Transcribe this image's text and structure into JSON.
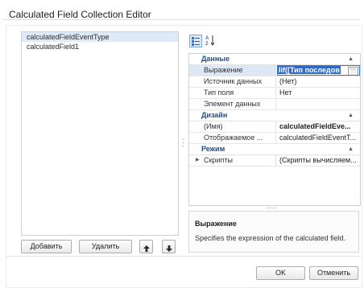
{
  "window": {
    "title": "Calculated Field Collection Editor"
  },
  "list": {
    "items": [
      "calculatedFieldEventType",
      "calculatedField1"
    ],
    "selected_index": 0
  },
  "buttons": {
    "add": "Добавить",
    "remove": "Удалить",
    "ok": "OK",
    "cancel": "Отменить"
  },
  "toolbar": {
    "categorized_icon": "categorized-icon",
    "alphabetical_icon": "sort-az-icon"
  },
  "property_grid": {
    "categories": [
      {
        "name": "Данные",
        "rows": [
          {
            "name": "Выражение",
            "value": "Iif([Тип последов"
          },
          {
            "name": "Источник данных",
            "value": "(Нет)"
          },
          {
            "name": "Тип поля",
            "value": "Нет"
          },
          {
            "name": "Элемент данных",
            "value": ""
          }
        ]
      },
      {
        "name": "Дизайн",
        "rows": [
          {
            "name": "(Имя)",
            "value": "calculatedFieldEve..."
          },
          {
            "name": "Отображаемое ...",
            "value": "calculatedFieldEventT..."
          }
        ]
      },
      {
        "name": "Режим",
        "rows": [
          {
            "name": "Скрипты",
            "value": "(Скрипты вычисляем..."
          }
        ]
      }
    ]
  },
  "description": {
    "title": "Выражение",
    "text": "Specifies the expression of the calculated field."
  },
  "colors": {
    "category": "#1e4e8c",
    "selection": "#ddeaf8",
    "edit_highlight": "#316ac5"
  }
}
